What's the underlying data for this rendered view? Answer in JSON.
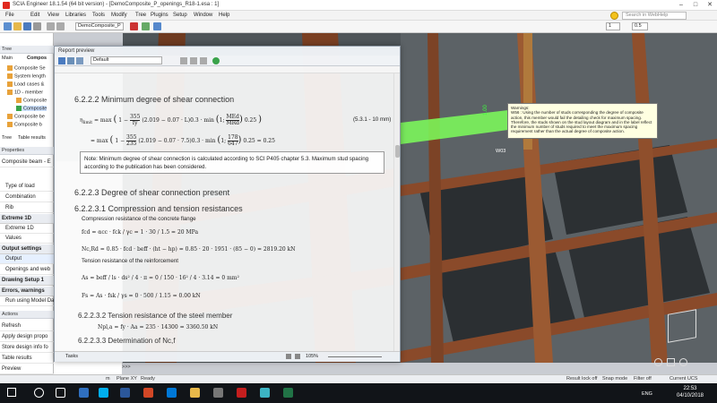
{
  "window": {
    "title": "SCIA Engineer 18.1.54 (64 bit version) - [DemoComposite_P_openings_R18-1.esa : 1]"
  },
  "menu": [
    "File",
    "Edit",
    "View",
    "Libraries",
    "Tools",
    "Modify",
    "Tree",
    "Plugins",
    "Setup",
    "Window",
    "Help"
  ],
  "search_placeholder": "Search in WebHelp",
  "toolbar": {
    "project_combo": "DemoComposite_P",
    "spin1": "1",
    "spin2": "0.5"
  },
  "tree": {
    "title": "Tree",
    "tabs": [
      "Main",
      "Compos"
    ],
    "items": [
      "Composite Se",
      "System length",
      "Load cases &",
      "1D - member",
      "Composite",
      "Composite",
      "Composite be",
      "Composite b"
    ],
    "bottom_tabs": [
      "Tree",
      "Table results"
    ]
  },
  "properties": {
    "title": "Properties",
    "subtitle": "Composite beam - E",
    "rows": [
      "Type of load",
      "Combination",
      "Rib"
    ],
    "sections": [
      {
        "label": "Extreme 1D",
        "rows": [
          "Extreme 1D",
          "Values"
        ]
      },
      {
        "label": "Output settings",
        "rows": [
          "Output",
          "Openings and web"
        ]
      },
      {
        "label": "Drawing Setup 1",
        "rows": []
      },
      {
        "label": "Errors, warnings",
        "rows": [
          "Run using Model Da"
        ]
      }
    ]
  },
  "actions": {
    "title": "Actions",
    "items": [
      "Refresh",
      "Apply design propo",
      "Store design info fo",
      "Table results",
      "Preview"
    ],
    "preview_arrow": ">>>"
  },
  "report": {
    "title": "Report preview",
    "layout_combo": "Default",
    "heading": "6.2.2.2 Minimum degree of shear connection",
    "eq1_lhs": "η",
    "eq1_sub": "limit",
    "eq1_a": "= max",
    "eq1_b": "1 −",
    "eq1_frac_num": "355",
    "eq1_frac_den": "fy",
    "eq1_c": "(2.019 − 0.07 · L)0.3 ·",
    "eq1_d": "min",
    "eq1_e": "1;",
    "eq1_m_num": "MEd",
    "eq1_m_den": "MRd",
    "eq1_f": "0.25",
    "eq_ref": "(5.3.1 - 10 mm)",
    "eq2_a": "= max",
    "eq2_b": "1 −",
    "eq2_frac_num": "355",
    "eq2_frac_den": "235",
    "eq2_c": "(2.019 − 0.07 · 7.5)0.3 ·",
    "eq2_d": "min",
    "eq2_e": "1;",
    "eq2_m_num": "178",
    "eq2_m_den": "647",
    "eq2_f": "0.25 = 0.25",
    "note": "Note: Minimum degree of shear connection is calculated according to SCI P405 chapter 5.3. Maximum stud spacing according to the publication has been considered.",
    "h_degree": "6.2.2.3 Degree of shear connection present",
    "h_comp": "6.2.2.3.1 Compression and tension resistances",
    "comp_conc": "Compression resistance of the concrete flange",
    "fcd_eq": "fcd = αcc · fck / γc = 1 · 30 / 1.5 = 20 MPa",
    "ncrd_eq": "Nc,Rd = 0.85 · fcd · beff · (ht − hp) = 0.85 · 20 · 1951 · (85 − 0) = 2819.20 kN",
    "tens_reinf": "Tension resistance of the reinforcement",
    "as_eq": "As = beff / ls · ds² / 4 · π = 0 / 150 · 16² / 4 · 3.14 = 0 mm²",
    "fs_eq": "Fs = As · fsk / γs = 0 · 500 / 1.15 = 0.00 kN",
    "h_steel": "6.2.2.3.2 Tension resistance of the steel member",
    "npl_eq": "Npl,a = fy · Aa = 235 · 14300 = 3360.50 kN",
    "h_det": "6.2.2.3.3 Determination of Nc,f",
    "footer_tab": "Tasks",
    "zoom": "105%"
  },
  "warning": {
    "title": "Warnings:",
    "text": "W56 : Using the number of studs corresponding the degree of composite action, this member would fail the detailing check for maximum spacing. Therefore, the studs shown on the stud layout diagram and in the label reflect the minimum number of studs required to meet the maximum spacing requirement rather than the actual degree of composite action."
  },
  "viewport": {
    "dim_label": "1.00",
    "node_label": "W03"
  },
  "statusbar": {
    "units": "m",
    "plane": "Plane XY",
    "ready": "Ready",
    "result_lock": "Result lock off",
    "snap": "Snap mode",
    "filter": "Filter off",
    "ucs": "Current UCS"
  },
  "taskbar": {
    "lang": "ENG",
    "time": "22:53",
    "date": "04/10/2018"
  },
  "colors": {
    "beam": "#8a4a2a",
    "highlight": "#7dff5a",
    "accent": "#2f6fbf"
  }
}
